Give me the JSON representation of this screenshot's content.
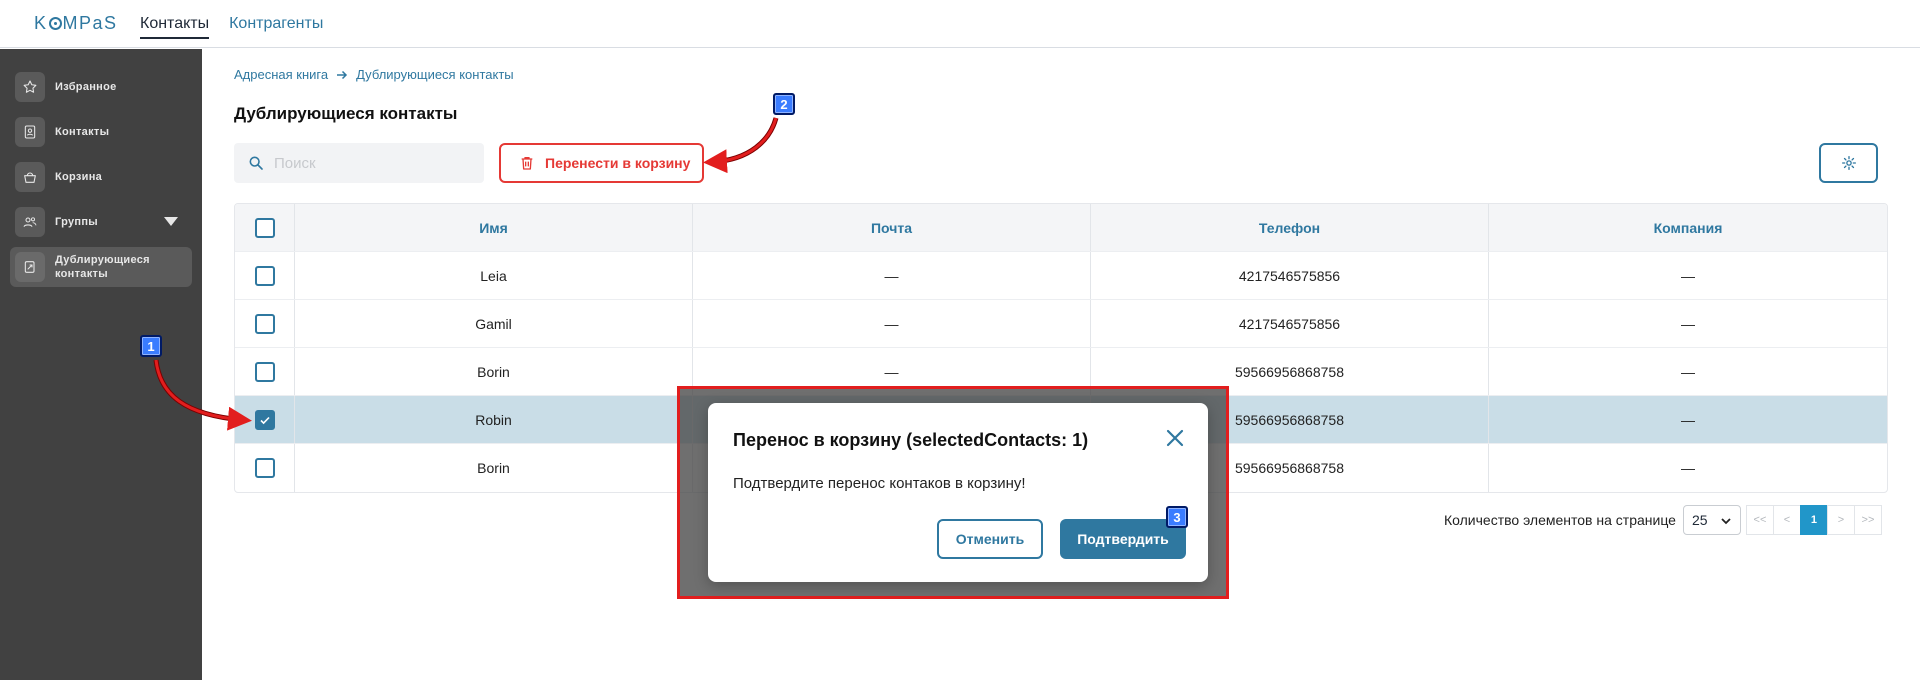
{
  "app": {
    "logo_text": "KOMPaS",
    "nav": [
      {
        "label": "Контакты",
        "active": true
      },
      {
        "label": "Контрагенты",
        "active": false
      }
    ]
  },
  "sidebar": {
    "items": [
      {
        "label": "Избранное",
        "icon": "star-icon"
      },
      {
        "label": "Контакты",
        "icon": "contact-card-icon"
      },
      {
        "label": "Корзина",
        "icon": "basket-icon"
      },
      {
        "label": "Группы",
        "icon": "group-icon"
      },
      {
        "label": "Дублирующиеся контакты",
        "icon": "duplicate-icon",
        "active": true
      }
    ]
  },
  "breadcrumb": {
    "items": [
      "Адресная книга",
      "Дублирующиеся контакты"
    ]
  },
  "page": {
    "title": "Дублирующиеся контакты"
  },
  "toolbar": {
    "search_placeholder": "Поиск",
    "move_to_trash_label": "Перенести в корзину"
  },
  "table": {
    "columns": [
      "Имя",
      "Почта",
      "Телефон",
      "Компания"
    ],
    "rows": [
      {
        "name": "Leia",
        "email": "—",
        "phone": "4217546575856",
        "company": "—",
        "checked": false
      },
      {
        "name": "Gamil",
        "email": "—",
        "phone": "4217546575856",
        "company": "—",
        "checked": false
      },
      {
        "name": "Borin",
        "email": "—",
        "phone": "59566956868758",
        "company": "—",
        "checked": false
      },
      {
        "name": "Robin",
        "email": "",
        "phone": "59566956868758",
        "company": "—",
        "checked": true
      },
      {
        "name": "Borin",
        "email": "",
        "phone": "59566956868758",
        "company": "—",
        "checked": false
      }
    ]
  },
  "pagination": {
    "label": "Количество элементов на странице",
    "page_size": "25",
    "buttons": [
      "<<",
      "<",
      "1",
      ">",
      ">>"
    ],
    "current_page": "1"
  },
  "modal": {
    "title": "Перенос в корзину (selectedContacts: 1)",
    "message": "Подтвердите перенос контаков в корзину!",
    "cancel_label": "Отменить",
    "confirm_label": "Подтвердить"
  },
  "annotations": {
    "badges": [
      "1",
      "2",
      "3"
    ]
  },
  "colors": {
    "accent": "#2f78a0",
    "danger": "#e53935",
    "sidebar_bg": "#414141",
    "selected_row": "#c9dde7",
    "page_active": "#2196c9",
    "annotation_frame": "#e21e1e",
    "annotation_badge": "#3a7cff"
  }
}
